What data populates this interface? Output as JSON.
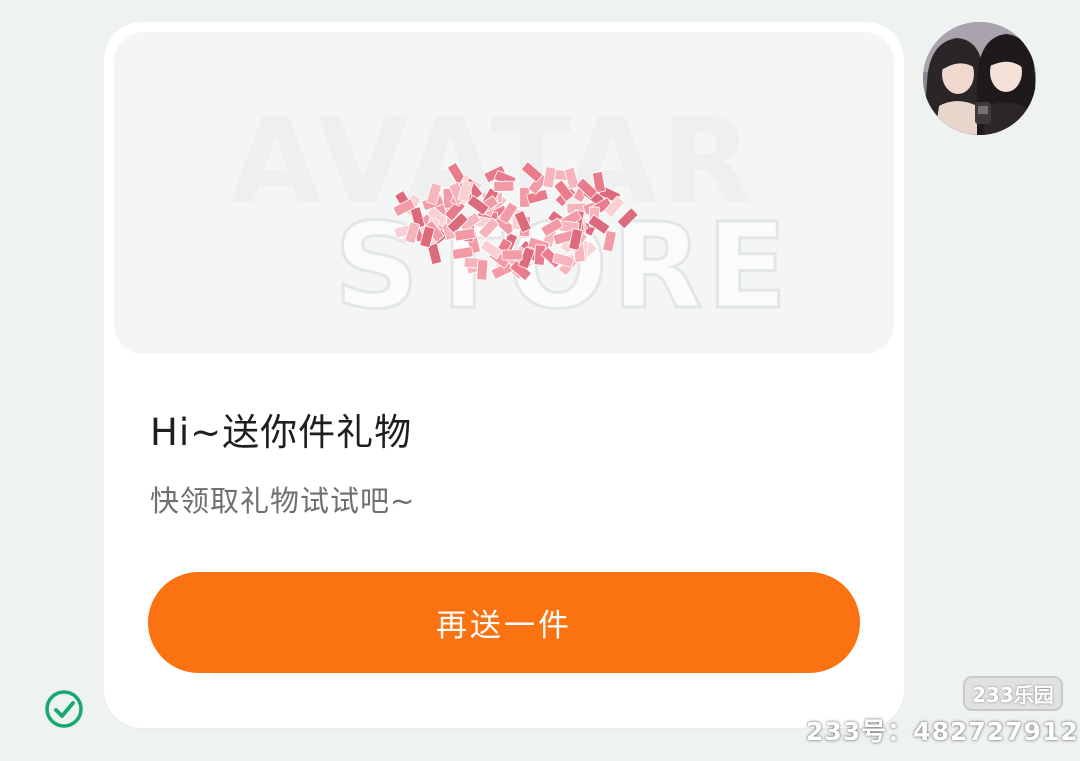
{
  "message": {
    "banner": {
      "watermark_line_1": "AVATAR",
      "watermark_line_2": "STORE",
      "gift_image": "banknote-pile"
    },
    "title": "Hi~送你件礼物",
    "subtitle": "快领取礼物试试吧~",
    "action_label": "再送一件"
  },
  "sender": {
    "avatar": "two-girls-selfie-photo"
  },
  "status": {
    "read_icon": "check-circle-icon",
    "read_color": "#16a86f"
  },
  "watermark": {
    "brand": "233乐园",
    "account": "233号：482727912"
  },
  "colors": {
    "accent": "#fb7211",
    "card": "#ffffff",
    "page": "#eef2f1"
  }
}
